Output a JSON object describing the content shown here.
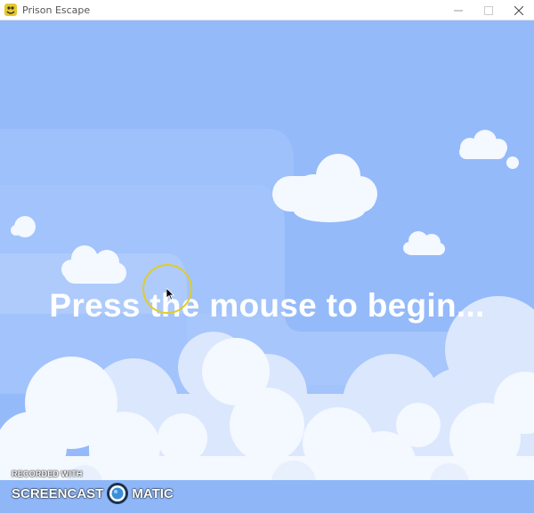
{
  "window": {
    "title": "Prison Escape",
    "icons": {
      "app": "pygame-snake-icon",
      "minimize": "minimize-icon",
      "maximize": "maximize-icon",
      "close": "close-icon"
    }
  },
  "game": {
    "prompt": "Press the mouse to begin...",
    "cursor": "arrow-pointer-icon"
  },
  "watermark": {
    "line1": "RECORDED WITH",
    "left": "SCREENCAST",
    "right": "MATIC",
    "logo": "screencast-o-matic-logo"
  },
  "colors": {
    "sky": "#94bafa",
    "sky_light": "#a9c8fb",
    "cloud": "#f4f8ff",
    "cloud_shade": "#dbe7fd",
    "text": "#ffffff",
    "cursor_ring": "#e0cc2a"
  }
}
